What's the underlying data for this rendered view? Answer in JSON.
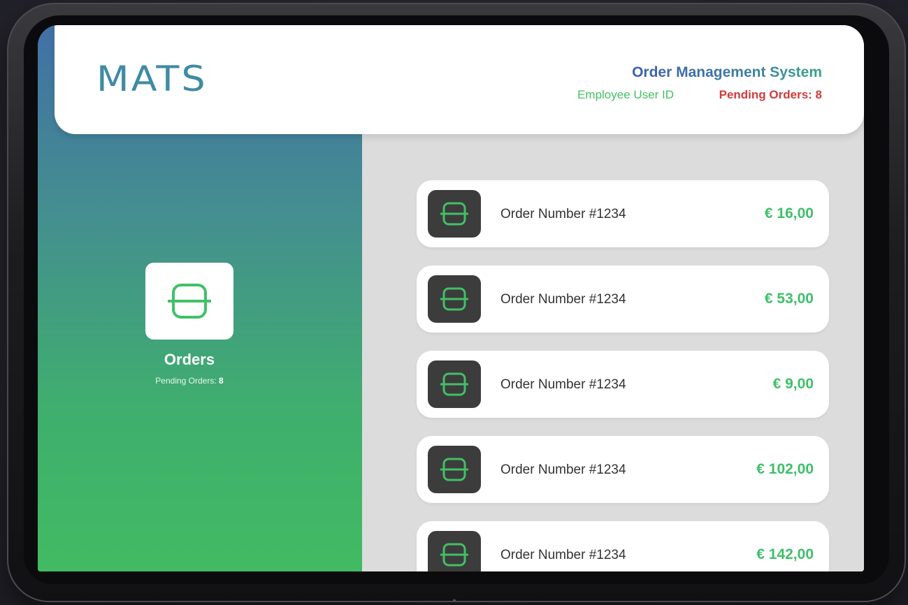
{
  "header": {
    "logo": "MATS",
    "title": "Order Management System",
    "employee_id": "Employee User ID",
    "pending_label": "Pending Orders: 8"
  },
  "sidebar": {
    "section_label": "Orders",
    "pending_prefix": "Pending Orders: ",
    "pending_count": "8",
    "icon": "orders-icon"
  },
  "orders": [
    {
      "name": "Order Number #1234",
      "price": "€ 16,00"
    },
    {
      "name": "Order Number #1234",
      "price": "€ 53,00"
    },
    {
      "name": "Order Number #1234",
      "price": "€ 9,00"
    },
    {
      "name": "Order Number #1234",
      "price": "€ 102,00"
    },
    {
      "name": "Order Number #1234",
      "price": "€ 142,00"
    }
  ],
  "colors": {
    "accent_green": "#41bb62",
    "accent_blue": "#3d5fae",
    "alert_red": "#cf3b3b",
    "icon_tile_dark": "#3c3c3c"
  }
}
